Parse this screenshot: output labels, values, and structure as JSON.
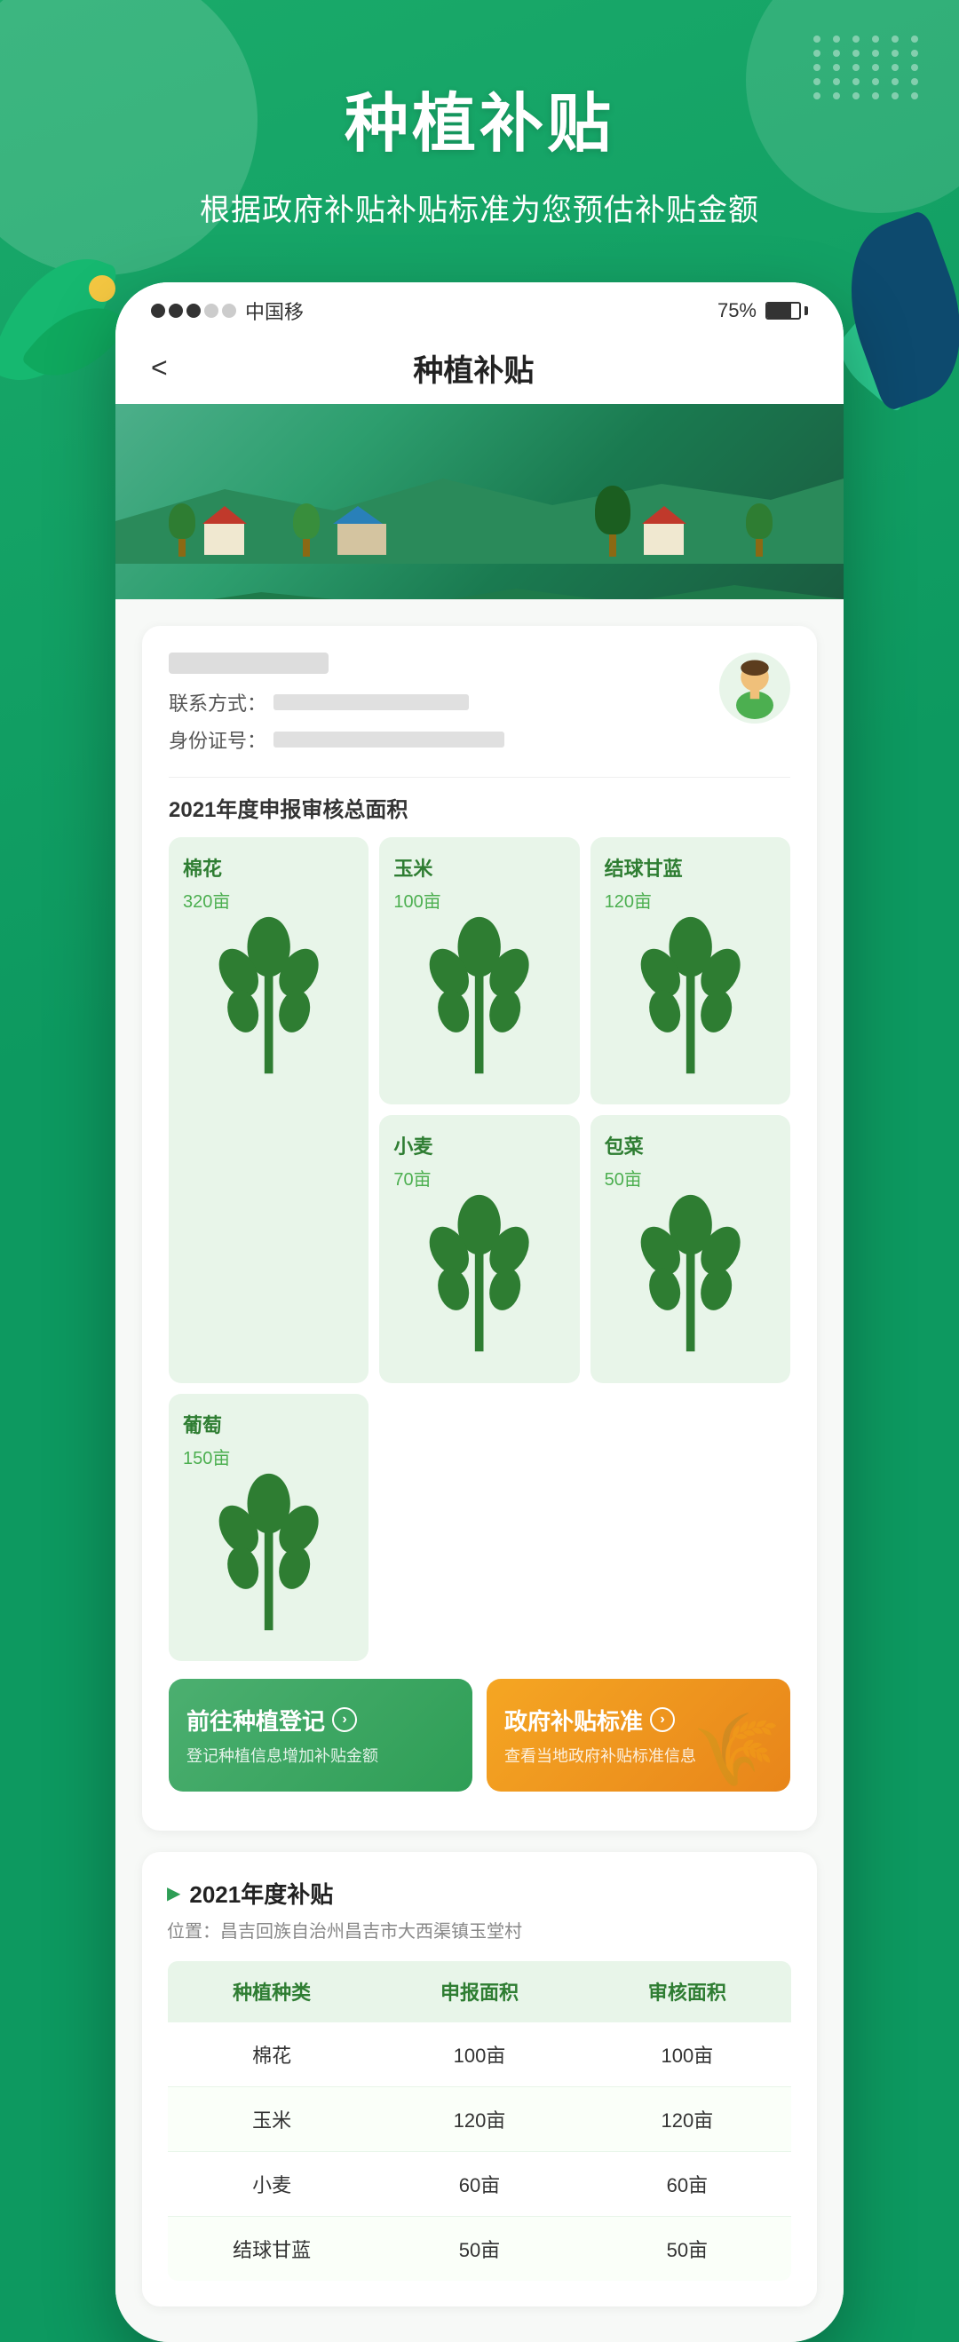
{
  "app": {
    "title": "种植补贴",
    "subtitle": "根据政府补贴补贴标准为您预估补贴金额"
  },
  "statusBar": {
    "signal": "●●●○○",
    "carrier": "中国移",
    "battery": "75%"
  },
  "nav": {
    "backLabel": "<",
    "title": "种植补贴"
  },
  "user": {
    "nameBlur": true,
    "contactLabel": "联系方式：",
    "idLabel": "身份证号："
  },
  "cropSection": {
    "title": "2021年度申报审核总面积",
    "crops": [
      {
        "name": "棉花",
        "area": "320亩",
        "large": true
      },
      {
        "name": "玉米",
        "area": "100亩",
        "large": false
      },
      {
        "name": "结球甘蓝",
        "area": "120亩",
        "large": false
      },
      {
        "name": "小麦",
        "area": "70亩",
        "large": false
      },
      {
        "name": "包菜",
        "area": "50亩",
        "large": false
      },
      {
        "name": "葡萄",
        "area": "150亩",
        "large": false
      }
    ]
  },
  "actions": [
    {
      "id": "planting-register",
      "title": "前往种植登记",
      "desc": "登记种植信息增加补贴金额",
      "color": "green"
    },
    {
      "id": "gov-standard",
      "title": "政府补贴标准",
      "desc": "查看当地政府补贴标准信息",
      "color": "orange"
    }
  ],
  "subsidySection": {
    "year": "2021年度补贴",
    "location": "位置：昌吉回族自治州昌吉市大西渠镇玉堂村",
    "tableHeaders": [
      "种植种类",
      "申报面积",
      "审核面积"
    ],
    "tableRows": [
      {
        "crop": "棉花",
        "declared": "100亩",
        "reviewed": "100亩"
      },
      {
        "crop": "玉米",
        "declared": "120亩",
        "reviewed": "120亩"
      },
      {
        "crop": "小麦",
        "declared": "60亩",
        "reviewed": "60亩"
      },
      {
        "crop": "结球甘蓝",
        "declared": "50亩",
        "reviewed": "50亩"
      }
    ]
  },
  "colors": {
    "primary": "#1aaa6a",
    "green_dark": "#2e7d32",
    "green_light": "#e8f5e9",
    "orange": "#f5a623",
    "text_dark": "#222222",
    "text_mid": "#555555",
    "text_light": "#888888"
  }
}
